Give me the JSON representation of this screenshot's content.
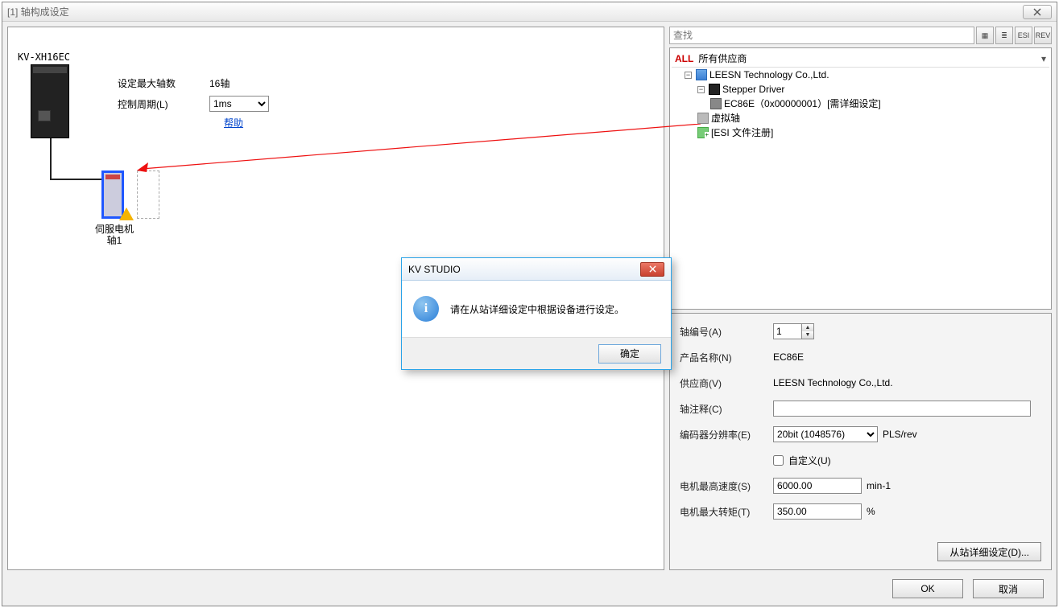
{
  "window": {
    "title": "[1] 轴构成设定"
  },
  "left": {
    "module_name": "KV-XH16EC",
    "max_axis_label": "设定最大轴数",
    "max_axis_value": "16轴",
    "cycle_label": "控制周期(L)",
    "cycle_value": "1ms",
    "help": "帮助",
    "servo_label_1": "伺服电机",
    "servo_label_2": "轴1"
  },
  "search": {
    "placeholder": "查找"
  },
  "toolbar": {
    "b1": "▦",
    "b2": "≣",
    "b3": "ESI",
    "b4": "REV"
  },
  "vendor_filter": {
    "all": "ALL",
    "label": "所有供应商"
  },
  "tree": {
    "vendor": "LEESN Technology Co.,Ltd.",
    "driver": "Stepper Driver",
    "device": "EC86E（0x00000001）[需详细设定]",
    "virtual": "虚拟轴",
    "esi": "[ESI 文件注册]"
  },
  "detail": {
    "axis_no_label": "轴编号(A)",
    "axis_no": "1",
    "product_label": "产品名称(N)",
    "product": "EC86E",
    "vendor_label": "供应商(V)",
    "vendor": "LEESN Technology Co.,Ltd.",
    "comment_label": "轴注释(C)",
    "comment": "",
    "encoder_label": "编码器分辨率(E)",
    "encoder_value": "20bit (1048576)",
    "encoder_unit": "PLS/rev",
    "custom_label": "自定义(U)",
    "speed_label": "电机最高速度(S)",
    "speed": "6000.00",
    "speed_unit": "min-1",
    "torque_label": "电机最大转矩(T)",
    "torque": "350.00",
    "torque_unit": "%",
    "detail_btn": "从站详细设定(D)..."
  },
  "footer": {
    "ok": "OK",
    "cancel": "取消"
  },
  "modal": {
    "title": "KV STUDIO",
    "message": "请在从站详细设定中根据设备进行设定。",
    "ok": "确定"
  }
}
